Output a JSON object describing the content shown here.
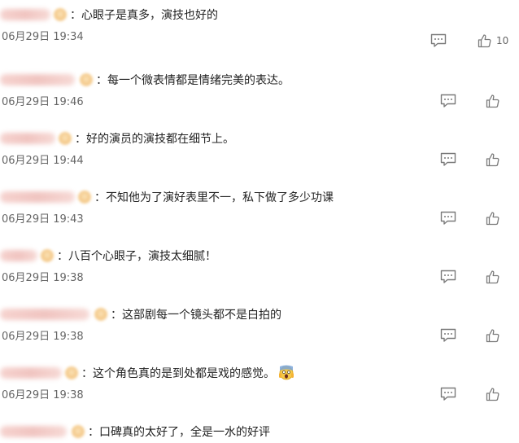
{
  "comments": [
    {
      "text": "心眼子是真多，演技也好的",
      "time": "06月29日 19:34",
      "likes": "10"
    },
    {
      "text": "每一个微表情都是情绪完美的表达。",
      "time": "06月29日 19:46",
      "likes": ""
    },
    {
      "text": "好的演员的演技都在细节上。",
      "time": "06月29日 19:44",
      "likes": ""
    },
    {
      "text": "不知他为了演好表里不一，私下做了多少功课",
      "time": "06月29日 19:43",
      "likes": ""
    },
    {
      "text": "八百个心眼子，演技太细腻！",
      "time": "06月29日 19:38",
      "likes": ""
    },
    {
      "text": "这部剧每一个镜头都不是白拍的",
      "time": "06月29日 19:38",
      "likes": ""
    },
    {
      "text": "这个角色真的是到处都是戏的感觉。",
      "time": "06月29日 19:38",
      "likes": "",
      "emoji": "scream-emoji-icon"
    },
    {
      "text": "口碑真的太好了，全是一水的好评",
      "time": "",
      "likes": ""
    }
  ],
  "separator": "：",
  "icons": {
    "reply": "comment-icon",
    "like": "thumbs-up-icon",
    "icon_color": "#7a7a7a"
  },
  "colors": {
    "text": "#222222",
    "time": "#666666",
    "username_blur": "#f0c4c0"
  }
}
